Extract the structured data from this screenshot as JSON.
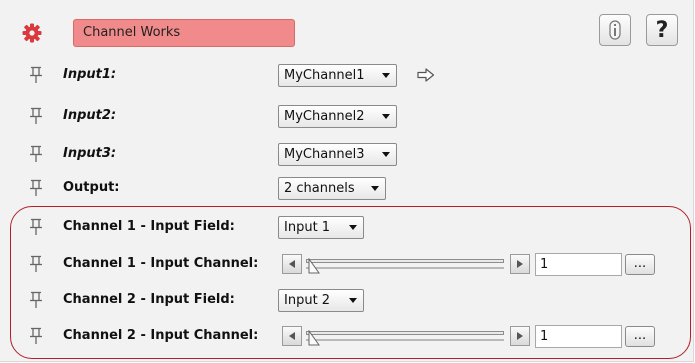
{
  "header": {
    "node_icon": "red-gear-icon",
    "title": "Channel Works",
    "info_icon": "info-icon",
    "help_label": "?"
  },
  "params": {
    "input1": {
      "label": "Input1:",
      "value": "MyChannel1",
      "extra_icon": "arrow-right-icon"
    },
    "input2": {
      "label": "Input2:",
      "value": "MyChannel2"
    },
    "input3": {
      "label": "Input3:",
      "value": "MyChannel3"
    },
    "output": {
      "label": "Output:",
      "value": "2 channels"
    },
    "ch1_field": {
      "label": "Channel 1 - Input Field:",
      "value": "Input 1"
    },
    "ch1_channel": {
      "label": "Channel 1 - Input Channel:",
      "value": "1",
      "more_label": "...",
      "slider_fraction": 0.0
    },
    "ch2_field": {
      "label": "Channel 2 - Input Field:",
      "value": "Input 2"
    },
    "ch2_channel": {
      "label": "Channel 2 - Input Channel:",
      "value": "1",
      "more_label": "...",
      "slider_fraction": 0.0
    }
  },
  "colors": {
    "title_bg": "#f18a8a",
    "highlight_border": "#b0202a",
    "panel_bg": "#f2f2f2"
  }
}
